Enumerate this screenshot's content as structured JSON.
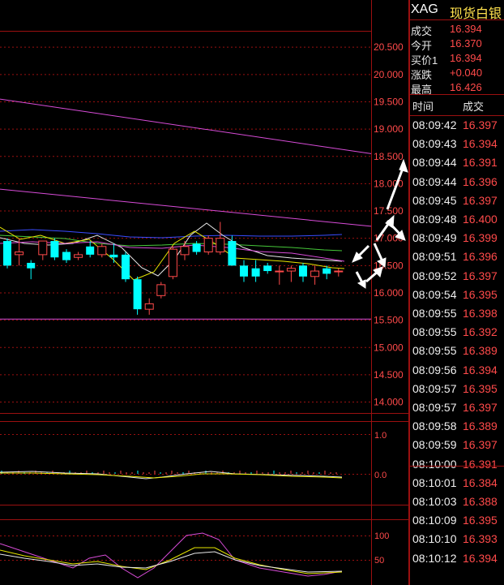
{
  "instrument": {
    "code": "XAG",
    "name": "现货白银"
  },
  "quote": [
    {
      "label": "成交",
      "value": "16.394"
    },
    {
      "label": "今开",
      "value": "16.370"
    },
    {
      "label": "买价1",
      "value": "16.394"
    },
    {
      "label": "涨跌",
      "value": "+0.040"
    },
    {
      "label": "最高",
      "value": "16.426"
    }
  ],
  "ticks_header": {
    "time": "时间",
    "price": "成交"
  },
  "ticks": [
    {
      "time": "08:09:42",
      "price": "16.397"
    },
    {
      "time": "08:09:43",
      "price": "16.394"
    },
    {
      "time": "08:09:44",
      "price": "16.391"
    },
    {
      "time": "08:09:44",
      "price": "16.396"
    },
    {
      "time": "08:09:45",
      "price": "16.397"
    },
    {
      "time": "08:09:48",
      "price": "16.400"
    },
    {
      "time": "08:09:49",
      "price": "16.399"
    },
    {
      "time": "08:09:51",
      "price": "16.396"
    },
    {
      "time": "08:09:52",
      "price": "16.397"
    },
    {
      "time": "08:09:54",
      "price": "16.395"
    },
    {
      "time": "08:09:55",
      "price": "16.398"
    },
    {
      "time": "08:09:55",
      "price": "16.392"
    },
    {
      "time": "08:09:55",
      "price": "16.389"
    },
    {
      "time": "08:09:56",
      "price": "16.394"
    },
    {
      "time": "08:09:57",
      "price": "16.395"
    },
    {
      "time": "08:09:57",
      "price": "16.397"
    },
    {
      "time": "08:09:58",
      "price": "16.389"
    },
    {
      "time": "08:09:59",
      "price": "16.397"
    },
    {
      "time": "08:10:00",
      "price": "16.391"
    },
    {
      "time": "08:10:01",
      "price": "16.384"
    },
    {
      "time": "08:10:03",
      "price": "16.388"
    },
    {
      "time": "08:10:09",
      "price": "16.395"
    },
    {
      "time": "08:10:10",
      "price": "16.393"
    },
    {
      "time": "08:10:12",
      "price": "16.394"
    }
  ],
  "colors": {
    "grid": "#9b1010",
    "up": "#ff4a4a",
    "down": "#00ffff",
    "axis_text": "#ff4a4a",
    "title_yellow": "#ffe14d"
  },
  "chart_data": [
    {
      "type": "candlestick",
      "ylim": [
        13.8,
        20.8
      ],
      "y_ticks": [
        "20.500",
        "20.000",
        "19.500",
        "19.000",
        "18.500",
        "18.000",
        "17.500",
        "17.000",
        "16.500",
        "16.000",
        "15.500",
        "15.000",
        "14.500",
        "14.000"
      ],
      "candles": [
        {
          "o": 16.95,
          "h": 17.0,
          "l": 16.45,
          "c": 16.5
        },
        {
          "o": 16.7,
          "h": 17.0,
          "l": 16.5,
          "c": 16.75
        },
        {
          "o": 16.55,
          "h": 16.6,
          "l": 16.25,
          "c": 16.45
        },
        {
          "o": 16.7,
          "h": 16.95,
          "l": 16.6,
          "c": 16.95
        },
        {
          "o": 16.95,
          "h": 17.0,
          "l": 16.6,
          "c": 16.65
        },
        {
          "o": 16.75,
          "h": 16.8,
          "l": 16.55,
          "c": 16.6
        },
        {
          "o": 16.65,
          "h": 16.75,
          "l": 16.6,
          "c": 16.7
        },
        {
          "o": 16.85,
          "h": 16.95,
          "l": 16.65,
          "c": 16.7
        },
        {
          "o": 16.7,
          "h": 16.9,
          "l": 16.65,
          "c": 16.85
        },
        {
          "o": 16.7,
          "h": 16.9,
          "l": 16.55,
          "c": 16.65
        },
        {
          "o": 16.7,
          "h": 16.75,
          "l": 16.2,
          "c": 16.25
        },
        {
          "o": 16.25,
          "h": 16.3,
          "l": 15.6,
          "c": 15.7
        },
        {
          "o": 15.7,
          "h": 15.9,
          "l": 15.6,
          "c": 15.8
        },
        {
          "o": 15.95,
          "h": 16.2,
          "l": 15.9,
          "c": 16.15
        },
        {
          "o": 16.3,
          "h": 16.85,
          "l": 16.25,
          "c": 16.8
        },
        {
          "o": 16.7,
          "h": 16.95,
          "l": 16.6,
          "c": 16.85
        },
        {
          "o": 16.9,
          "h": 16.95,
          "l": 16.7,
          "c": 16.75
        },
        {
          "o": 16.75,
          "h": 17.05,
          "l": 16.7,
          "c": 17.0
        },
        {
          "o": 16.75,
          "h": 17.3,
          "l": 16.7,
          "c": 17.0
        },
        {
          "o": 16.95,
          "h": 17.05,
          "l": 16.5,
          "c": 16.5
        },
        {
          "o": 16.5,
          "h": 16.6,
          "l": 16.2,
          "c": 16.3
        },
        {
          "o": 16.45,
          "h": 16.6,
          "l": 16.2,
          "c": 16.3
        },
        {
          "o": 16.5,
          "h": 16.55,
          "l": 16.35,
          "c": 16.4
        },
        {
          "o": 16.4,
          "h": 16.5,
          "l": 16.15,
          "c": 16.4
        },
        {
          "o": 16.4,
          "h": 16.5,
          "l": 16.2,
          "c": 16.45
        },
        {
          "o": 16.5,
          "h": 16.55,
          "l": 16.2,
          "c": 16.3
        },
        {
          "o": 16.3,
          "h": 16.5,
          "l": 16.15,
          "c": 16.4
        },
        {
          "o": 16.45,
          "h": 16.5,
          "l": 16.25,
          "c": 16.35
        },
        {
          "o": 16.4,
          "h": 16.45,
          "l": 16.3,
          "c": 16.4
        }
      ],
      "trendlines": [
        {
          "from": [
            0,
            19.55
          ],
          "to": [
            29,
            18.55
          ]
        },
        {
          "from": [
            0,
            17.9
          ],
          "to": [
            29,
            17.22
          ]
        },
        {
          "from": [
            0,
            15.52
          ],
          "to": [
            29,
            15.52
          ]
        }
      ]
    },
    {
      "type": "line",
      "ylim": [
        -0.2,
        1.2
      ],
      "y_ticks": [
        "1.0",
        "0.0"
      ]
    },
    {
      "type": "line",
      "ylim": [
        30,
        110
      ],
      "y_ticks": [
        "100",
        "50"
      ]
    }
  ]
}
